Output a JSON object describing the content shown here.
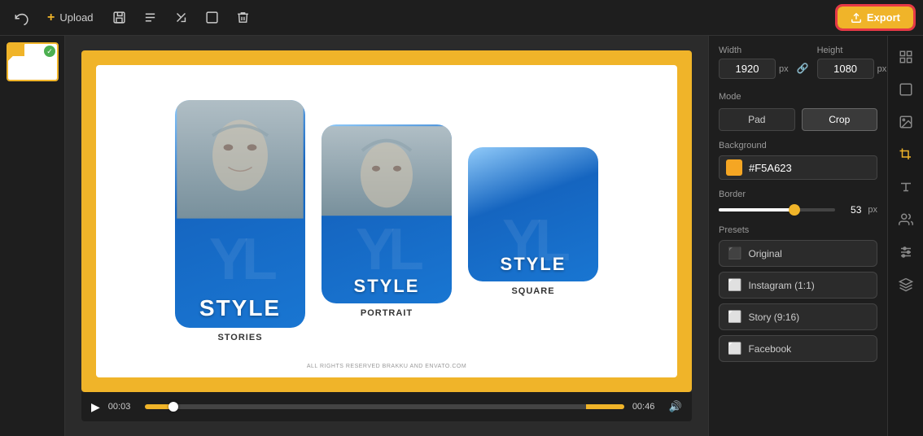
{
  "toolbar": {
    "upload_label": "Upload",
    "export_label": "Export"
  },
  "canvas": {
    "copyright_text": "ALL RIGHTS RESERVED BRAKKU AND ENVATO.COM"
  },
  "playback": {
    "time_start": "00:03",
    "time_end": "00:46"
  },
  "right_panel": {
    "width_label": "Width",
    "height_label": "Height",
    "width_value": "1920",
    "height_value": "1080",
    "px_unit": "px",
    "mode_label": "Mode",
    "mode_pad": "Pad",
    "mode_crop": "Crop",
    "background_label": "Background",
    "bg_color": "#F5A623",
    "border_label": "Border",
    "border_value": "53",
    "presets_label": "Presets",
    "presets": [
      {
        "icon": "⬛",
        "label": "Original"
      },
      {
        "icon": "⬜",
        "label": "Instagram (1:1)"
      },
      {
        "icon": "⬜",
        "label": "Story (9:16)"
      },
      {
        "icon": "⬜",
        "label": "Facebook"
      }
    ]
  },
  "cards": [
    {
      "label": "STORIES",
      "style": "STYLE"
    },
    {
      "label": "PORTRAIT",
      "style": "STYLE"
    },
    {
      "label": "SQUARE",
      "style": "STYLE"
    }
  ],
  "icon_sidebar": [
    {
      "name": "grid-icon",
      "symbol": "⊞"
    },
    {
      "name": "frame-icon",
      "symbol": "▣"
    },
    {
      "name": "image-icon",
      "symbol": "🖼"
    },
    {
      "name": "crop-icon",
      "symbol": "⊡",
      "active": true
    },
    {
      "name": "text-icon",
      "symbol": "T"
    },
    {
      "name": "person-icon",
      "symbol": "👥"
    },
    {
      "name": "sliders-icon",
      "symbol": "⧖"
    },
    {
      "name": "layers-icon",
      "symbol": "⊟"
    }
  ]
}
